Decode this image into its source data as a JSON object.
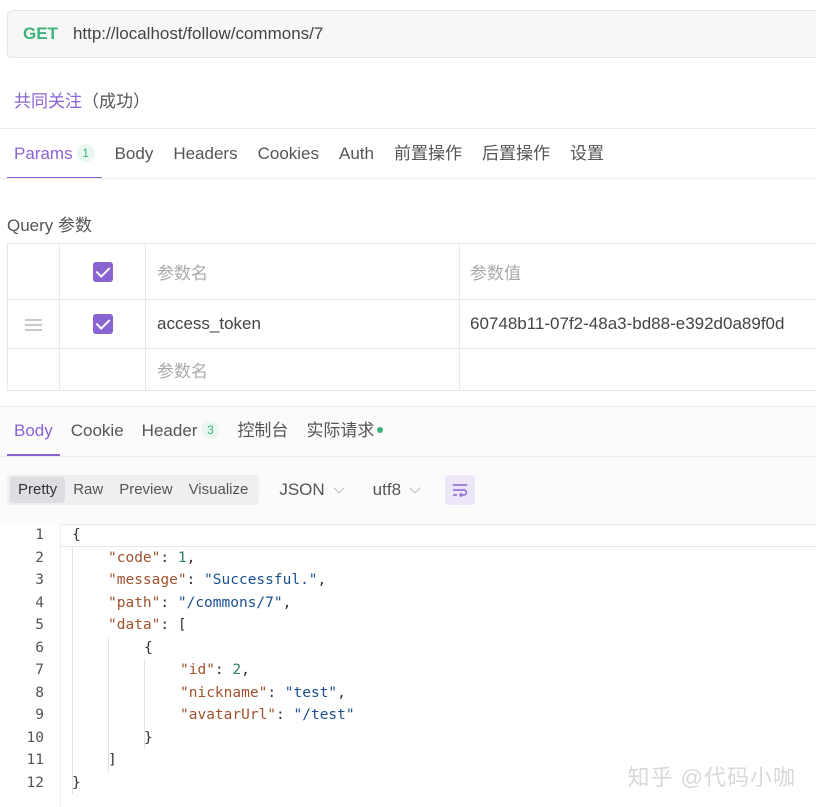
{
  "request": {
    "method": "GET",
    "url": "http://localhost/follow/commons/7"
  },
  "api_name": {
    "title": "共同关注",
    "status": "（成功）"
  },
  "request_tabs": [
    {
      "label": "Params",
      "badge": "1"
    },
    {
      "label": "Body"
    },
    {
      "label": "Headers"
    },
    {
      "label": "Cookies"
    },
    {
      "label": "Auth"
    },
    {
      "label": "前置操作"
    },
    {
      "label": "后置操作"
    },
    {
      "label": "设置"
    }
  ],
  "query_section_title": "Query 参数",
  "params_table": {
    "header_name": "参数名",
    "header_value": "参数值",
    "rows": [
      {
        "name": "access_token",
        "value": "60748b11-07f2-48a3-bd88-e392d0a89f0d"
      }
    ],
    "new_row_placeholder": "参数名"
  },
  "response_tabs": [
    {
      "label": "Body"
    },
    {
      "label": "Cookie"
    },
    {
      "label": "Header",
      "badge": "3"
    },
    {
      "label": "控制台"
    },
    {
      "label": "实际请求"
    }
  ],
  "view_modes": [
    "Pretty",
    "Raw",
    "Preview",
    "Visualize"
  ],
  "format_select": "JSON",
  "encoding_select": "utf8",
  "code_lines": [
    {
      "num": "1",
      "text": "{"
    },
    {
      "num": "2",
      "key": "\"code\"",
      "value": "1",
      "vtype": "n",
      "tail": ","
    },
    {
      "num": "3",
      "key": "\"message\"",
      "value": "\"Successful.\"",
      "vtype": "s",
      "tail": ","
    },
    {
      "num": "4",
      "key": "\"path\"",
      "value": "\"/commons/7\"",
      "vtype": "s",
      "tail": ","
    },
    {
      "num": "5",
      "key": "\"data\"",
      "value": "[",
      "vtype": "p",
      "tail": ""
    },
    {
      "num": "6",
      "text": "{"
    },
    {
      "num": "7",
      "key": "\"id\"",
      "value": "2",
      "vtype": "n",
      "tail": ","
    },
    {
      "num": "8",
      "key": "\"nickname\"",
      "value": "\"test\"",
      "vtype": "s",
      "tail": ","
    },
    {
      "num": "9",
      "key": "\"avatarUrl\"",
      "value": "\"/test\"",
      "vtype": "s",
      "tail": ""
    },
    {
      "num": "10",
      "text": "}"
    },
    {
      "num": "11",
      "text": "]"
    },
    {
      "num": "12",
      "text": "}"
    }
  ],
  "watermark": "知乎 @代码小咖"
}
